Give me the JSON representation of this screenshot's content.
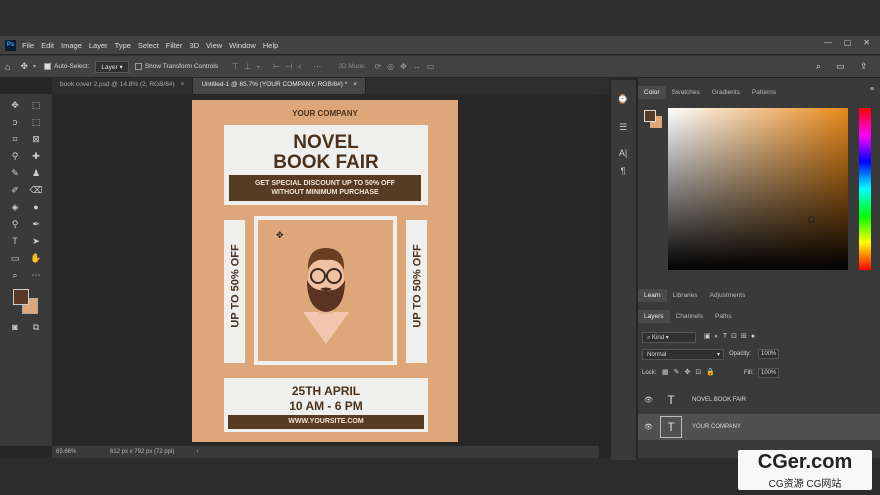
{
  "menubar": {
    "logo": "Ps",
    "items": [
      "File",
      "Edit",
      "Image",
      "Layer",
      "Type",
      "Select",
      "Filter",
      "3D",
      "View",
      "Window",
      "Help"
    ]
  },
  "options_bar": {
    "auto_select_label": "Auto-Select:",
    "auto_select_value": "Layer",
    "transform_label": "Show Transform Controls",
    "mode_3d_label": "3D Mode:"
  },
  "tabs": [
    {
      "label": "book cover 2.psd @ 14.8% (2, RGB/8#)"
    },
    {
      "label": "Untitled-1 @ 65.7% (YOUR COMPANY, RGB/8#) *"
    }
  ],
  "document": {
    "company": "YOUR COMPANY",
    "title_line1": "NOVEL",
    "title_line2": "BOOK FAIR",
    "discount_line1": "GET SPECIAL DISCOUNT UP TO 50% OFF",
    "discount_line2": "WITHOUT MINIMUM PURCHASE",
    "side_left": "UP TO 50% OFF",
    "side_right": "UP TO 50% OFF",
    "date": "25TH APRIL",
    "time": "10 AM - 6 PM",
    "website": "WWW.YOURSITE.COM",
    "colors": {
      "background": "#dda77a",
      "dark": "#573b22",
      "panel": "#efefee"
    }
  },
  "status": {
    "zoom": "65.66%",
    "size": "612 px x 792 px (72 ppi)",
    "arrow": "›"
  },
  "color_panel": {
    "tabs": [
      "Color",
      "Swatches",
      "Gradients",
      "Patterns"
    ],
    "foreground": "#5a3a22",
    "background": "#dda77a",
    "hue_color": "#e8891a"
  },
  "learn_tabs": [
    "Learn",
    "Libraries",
    "Adjustments"
  ],
  "layers_panel": {
    "tabs": [
      "Layers",
      "Channels",
      "Paths"
    ],
    "kind_label": "Kind",
    "blend_mode": "Normal",
    "opacity_label": "Opacity:",
    "opacity_value": "100%",
    "lock_label": "Lock:",
    "fill_label": "Fill:",
    "fill_value": "100%",
    "layers": [
      {
        "name": "NOVEL  BOOK FAIR"
      },
      {
        "name": "YOUR COMPANY"
      }
    ]
  },
  "watermark": {
    "line1": "CGer.com",
    "line2": "CG资源 CG网站"
  }
}
